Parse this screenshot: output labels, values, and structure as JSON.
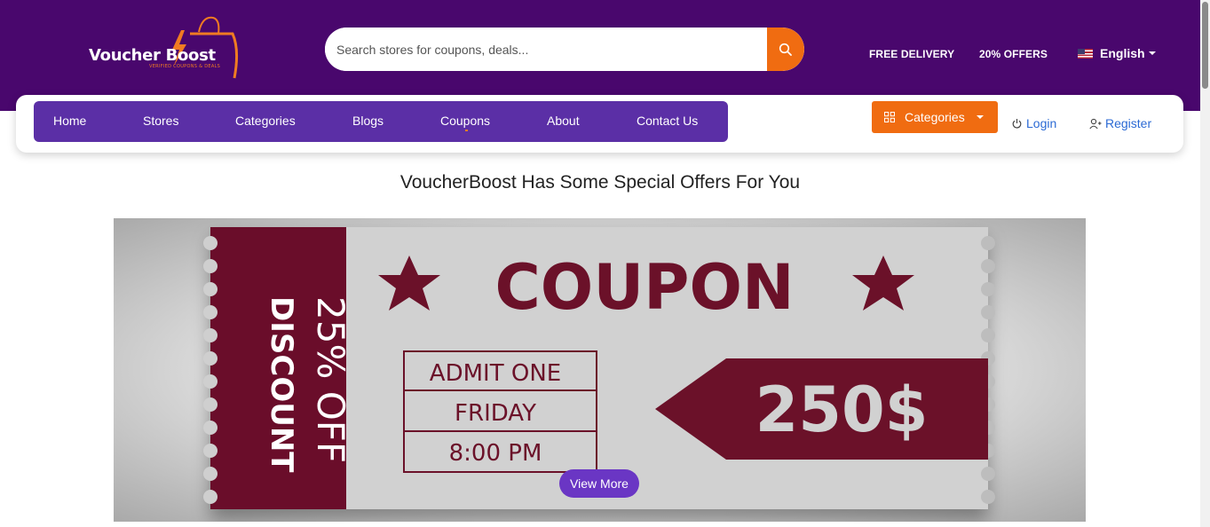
{
  "brand": {
    "logo_text": "Voucher Boost",
    "logo_tagline": "VERIFIED COUPONS & DEALS"
  },
  "search": {
    "placeholder": "Search stores for coupons, deals...",
    "icon": "search-icon"
  },
  "top_links": {
    "free_delivery": "FREE DELIVERY",
    "offers": "20% OFFERS"
  },
  "language": {
    "label": "English",
    "flag": "us-flag-icon"
  },
  "nav": {
    "items": [
      "Home",
      "Stores",
      "Categories",
      "Blogs",
      "Coupons",
      "About",
      "Contact Us"
    ]
  },
  "actions": {
    "categories_label": "Categories",
    "login_label": "Login",
    "register_label": "Register"
  },
  "main": {
    "heading": "VoucherBoost Has Some Special Offers For You",
    "view_more_label": "View More"
  },
  "coupon": {
    "title": "COUPON",
    "side_big": "25% OFF",
    "side_small": "DISCOUNT",
    "rows": [
      "ADMIT ONE",
      "FRIDAY",
      "8:00 PM"
    ],
    "price": "250$"
  },
  "colors": {
    "header_bg": "#49076d",
    "nav_bg": "#5b2fa6",
    "accent_orange": "#f06c11",
    "link_blue": "#2b6ad4",
    "coupon_maroon": "#6b1129",
    "button_purple": "#6a36c4"
  }
}
